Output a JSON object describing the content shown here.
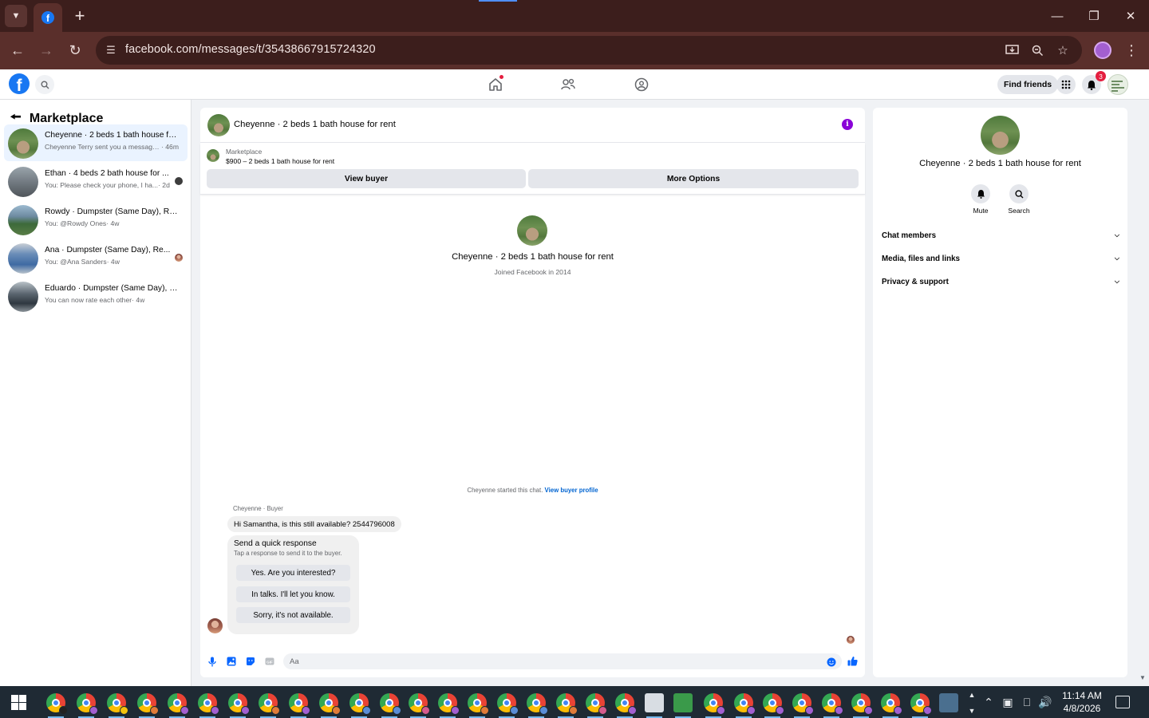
{
  "browser": {
    "url": "facebook.com/messages/t/35438667915724320",
    "tab_favicon": "f"
  },
  "header": {
    "find_friends_label": "Find friends",
    "notification_count": "3"
  },
  "sidebar": {
    "title": "Marketplace",
    "conversations": [
      {
        "name": "Cheyenne · 2 beds 1 bath house fo...",
        "preview": "Cheyenne Terry sent you a message ...",
        "age": " · 46m",
        "avatar": "house",
        "active": true
      },
      {
        "name": "Ethan · 4 beds 2 bath house for ...",
        "preview": "You: Please check your phone, I ha...",
        "age": " · 2d",
        "avatar": "gray",
        "active": false
      },
      {
        "name": "Rowdy · Dumpster (Same Day), Re...",
        "preview": "You: @Rowdy Ones",
        "age": " · 4w",
        "avatar": "dump",
        "active": false
      },
      {
        "name": "Ana · Dumpster (Same Day), Re...",
        "preview": "You: @Ana Sanders",
        "age": " · 4w",
        "avatar": "blue",
        "active": false
      },
      {
        "name": "Eduardo · Dumpster (Same Day), R...",
        "preview": "You can now rate each other",
        "age": " · 4w",
        "avatar": "dark",
        "active": false
      }
    ]
  },
  "chat": {
    "title": "Cheyenne · 2 beds 1 bath house for rent",
    "listing_category": "Marketplace",
    "listing_price": "$900 – 2 beds 1 bath house for rent",
    "view_buyer_label": "View buyer",
    "more_options_label": "More Options",
    "intro_name": "Cheyenne · 2 beds 1 bath house for rent",
    "intro_joined": "Joined Facebook in 2014",
    "started_text": "Cheyenne started this chat.",
    "view_buyer_profile_label": "View buyer profile",
    "sender_label": "Cheyenne · Buyer",
    "message": "Hi Samantha, is this still available? 2544796008",
    "quick_title": "Send a quick response",
    "quick_subtitle": "Tap a response to send it to the buyer.",
    "quick_replies": [
      "Yes. Are you interested?",
      "In talks. I'll let you know.",
      "Sorry, it's not available."
    ],
    "input_placeholder": "Aa"
  },
  "info_panel": {
    "name": "Cheyenne · 2 beds 1 bath house for rent",
    "actions": [
      {
        "label": "Mute",
        "icon": "bell-icon"
      },
      {
        "label": "Search",
        "icon": "search-icon"
      }
    ],
    "sections": [
      "Chat members",
      "Media, files and links",
      "Privacy & support"
    ]
  },
  "taskbar": {
    "time": "11:14 AM",
    "date": "4/8/2026"
  },
  "colors": {
    "facebook_blue": "#1877f2",
    "info_purple": "#8a02d8",
    "link_blue": "#0064d1",
    "notification_red": "#e41e3f",
    "browser_frame": "#3c1e1c",
    "taskbar": "#1f2a34"
  }
}
